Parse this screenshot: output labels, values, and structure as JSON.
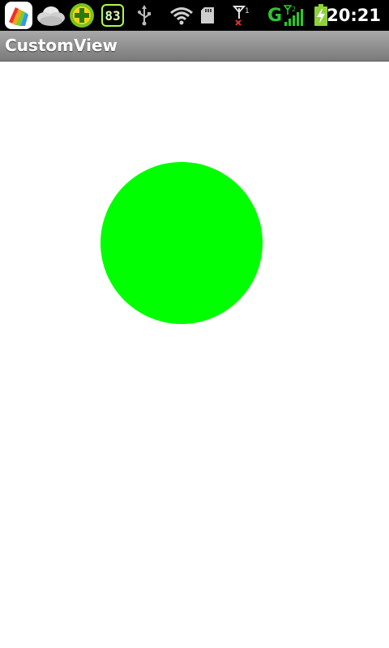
{
  "status_bar": {
    "time": "20:21",
    "notification_icons": [
      "app-launcher-icon",
      "weather-cloud-icon",
      "security-plus-icon",
      "battery-percent-badge"
    ],
    "battery_badge_text": "83",
    "system_icons": [
      "usb-icon",
      "wifi-icon",
      "sd-card-icon",
      "no-signal-antenna-icon",
      "network-type-icon",
      "signal-strength-icon",
      "battery-charging-icon"
    ],
    "network_type": "G",
    "colors": {
      "background": "#000000",
      "text": "#ffffff",
      "network": "#2fc52f"
    }
  },
  "app": {
    "title": "CustomView"
  },
  "custom_view": {
    "shape": "circle",
    "fill_color": "#00ff00"
  }
}
